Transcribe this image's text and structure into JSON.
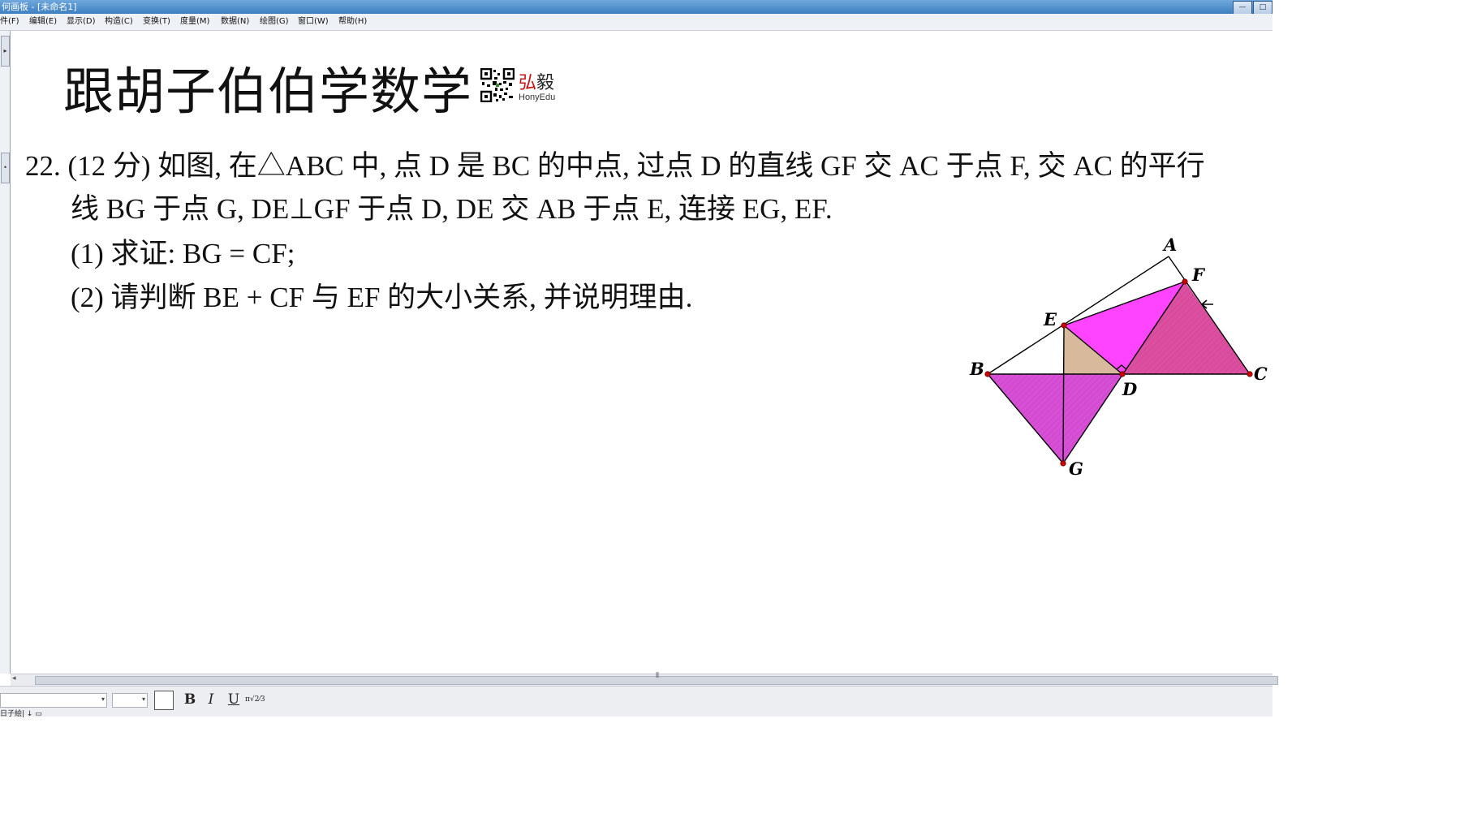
{
  "window": {
    "title": "何画板 - [未命名1]",
    "buttons": [
      "—",
      "□"
    ]
  },
  "menu": {
    "items": [
      "文件(F)",
      "编辑(E)",
      "显示(D)",
      "构造(C)",
      "变换(T)",
      "度量(M)",
      "数据(N)",
      "绘图(G)",
      "窗口(W)",
      "帮助(H)"
    ]
  },
  "canvas": {
    "heading": "跟胡子伯伯学数学",
    "brand_cn_1": "弘",
    "brand_cn_2": "毅",
    "brand_en": "HonyEdu",
    "problem": {
      "line1": "22. (12 分) 如图, 在△ABC 中, 点 D 是 BC 的中点, 过点 D 的直线 GF 交 AC 于点 F, 交 AC 的平行",
      "line2": "线 BG 于点 G, DE⊥GF 于点 D, DE 交 AB 于点 E, 连接 EG, EF.",
      "line3": "(1) 求证: BG = CF;",
      "line4": "(2) 请判断 BE + CF 与 EF 的大小关系, 并说明理由."
    },
    "diagram": {
      "labels": {
        "A": "A",
        "B": "B",
        "C": "C",
        "D": "D",
        "E": "E",
        "F": "F",
        "G": "G"
      },
      "colors": {
        "magenta": "#ff44ff",
        "pink": "#e0509a",
        "tan": "#d9b99b",
        "point": "#cc0000",
        "line": "#000000"
      }
    }
  },
  "formatbar": {
    "bold": "B",
    "italic": "I",
    "underline": "U",
    "symbol": "π√2⁄3"
  },
  "status": {
    "text": "日子絵|  ↓  ▭"
  }
}
